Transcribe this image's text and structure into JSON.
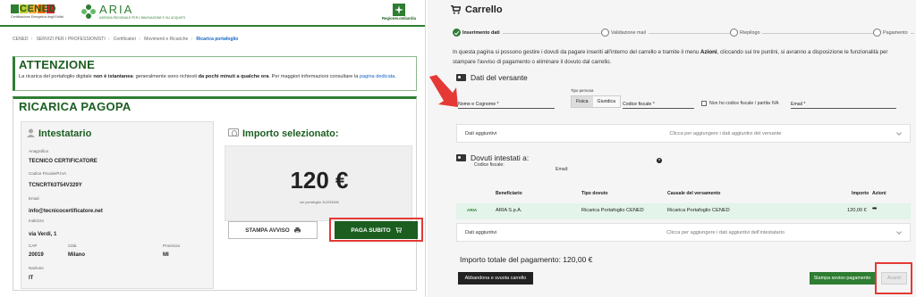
{
  "left": {
    "header": {
      "cened_logo": "CENED",
      "cened_tagline": "Certificazione Energetica degli Edifici",
      "aria_logo": "ARIA",
      "aria_tagline": "AZIENDA REGIONALE PER L'INNOVAZIONE E GLI ACQUISTI",
      "region_label": "RegioneLombardia"
    },
    "breadcrumb": {
      "items": [
        "CENED",
        "SERVIZI PER I PROFESSIONISTI",
        "Certificatori",
        "Movimenti e Ricariche"
      ],
      "current": "Ricarica portafoglio"
    },
    "attention": {
      "title": "ATTENZIONE",
      "text_1": "La ricarica del portafoglio digitale ",
      "text_bold_1": "non è istantanea",
      "text_2": ": generalmente sono richiesti ",
      "text_bold_2": "da pochi minuti a qualche ora",
      "text_3": ". Per maggiori informazioni consultare la ",
      "link": "pagina dedicata",
      "text_4": "."
    },
    "ricarica": {
      "title": "RICARICA PAGOPA",
      "intestatario": {
        "title": "Intestatario",
        "anagrafica_label": "Anagrafica",
        "anagrafica_value": "TECNICO CERTIFICATORE",
        "cf_label": "Codice Fiscale/P.IVA",
        "cf_value": "TCNCRT63T54V329Y",
        "email_label": "Email",
        "email_value": "info@tecnicocertificatore.net",
        "indirizzo_label": "Indirizzo",
        "indirizzo_value": "via Verdi, 1",
        "cap_label": "CAP",
        "cap_value": "20019",
        "citta_label": "Città",
        "citta_value": "Milano",
        "provincia_label": "Provincia",
        "provincia_value": "MI",
        "nazione_label": "Nazione",
        "nazione_value": "IT"
      },
      "importo": {
        "title": "Importo selezionato:",
        "amount": "120 €",
        "sub": "sul portafoglio 112233456"
      },
      "buttons": {
        "stampa": "STAMPA AVVISO",
        "paga": "PAGA SUBITO"
      }
    }
  },
  "right": {
    "title": "Carrello",
    "steps": [
      "Inserimento dati",
      "Validazione mail",
      "Riepilogo",
      "Pagamento"
    ],
    "intro_1": "In questa pagina si possono gestire i dovuti da pagare inseriti all'interno del carrello e tramite il menu ",
    "intro_bold": "Azioni",
    "intro_2": ", cliccando sui tre puntini, si avranno a disposizione le funzionalità per stampare l'avviso di pagamento o eliminare il dovuto dal carrello.",
    "versante": {
      "title": "Dati del versante",
      "nome_placeholder": "Nome e Cognome *",
      "tipo_label": "Tipo persona",
      "tipo_options": [
        "Fisica",
        "Giuridica"
      ],
      "cf_placeholder": "Codice fiscale *",
      "no_cf_label": "Non ho codice fiscale / partita IVA",
      "email_placeholder": "Email *",
      "aggiuntivi_label": "Dati aggiuntivi",
      "aggiuntivi_hint": "Clicca per aggiungere i dati aggiuntivi del versante"
    },
    "dovuti": {
      "title": "Dovuti intestati a:",
      "cf_label": "Codice fiscale:",
      "email_label": "Email:",
      "columns": [
        "Beneficiario",
        "Tipo dovuto",
        "Causale del versamento",
        "Importo",
        "Azioni"
      ],
      "rows": [
        {
          "logo": "ARIA",
          "beneficiario": "ARIA S.p.A.",
          "tipo": "Ricarica Portafoglio CENED",
          "causale": "Ricarica Portafoglio CENED",
          "importo": "120,00 €",
          "azioni": "•••"
        }
      ],
      "aggiuntivi_label": "Dati aggiuntivi",
      "aggiuntivi_hint": "Clicca per aggiungere i dati aggiuntivi dell'intestatario"
    },
    "totale": "Importo totale del pagamento: 120,00 €",
    "buttons": {
      "abbandona": "Abbandona e svuota carrello",
      "stampa": "Stampa avviso pagamento",
      "avanti": "Avanti"
    }
  },
  "colors": {
    "brand_green": "#1b5e20",
    "accent_green": "#2e7d32",
    "highlight_red": "#e53935",
    "row_highlight": "#e3f4ea"
  }
}
